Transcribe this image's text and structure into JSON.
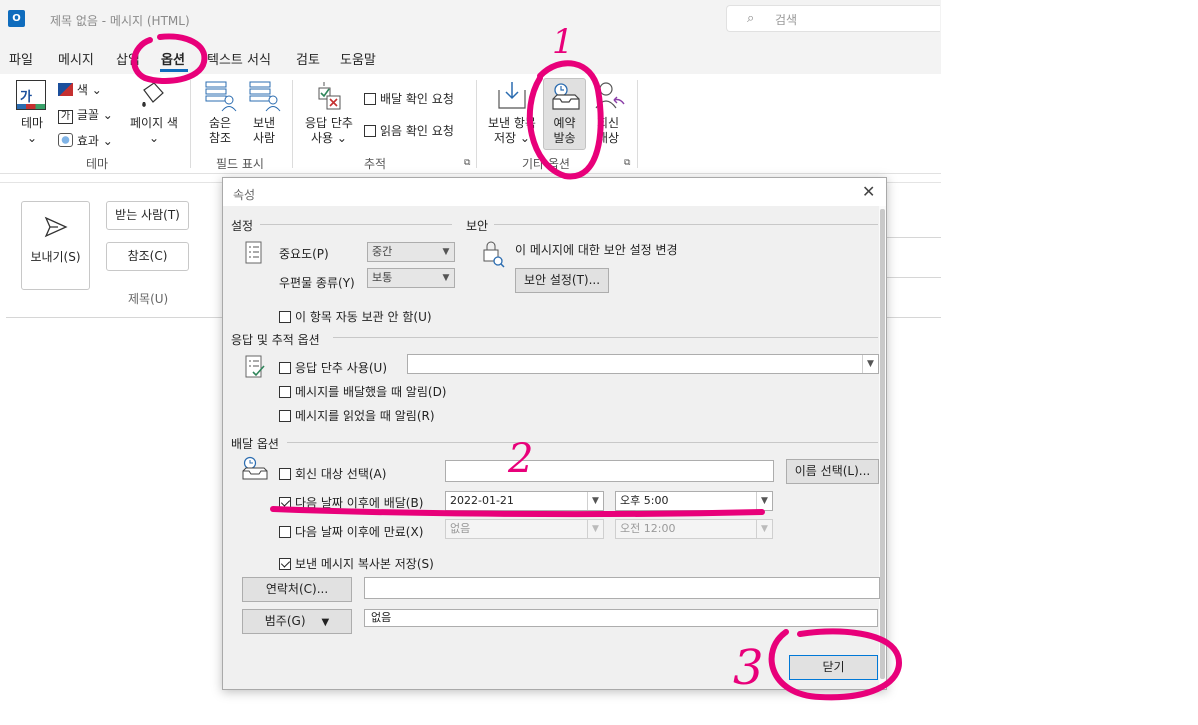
{
  "window": {
    "title": "제목 없음  -  메시지 (HTML)",
    "app_logo": "O",
    "search_placeholder": "검색"
  },
  "tabs": [
    "파일",
    "메시지",
    "삽입",
    "옵션",
    "텍스트 서식",
    "검토",
    "도움말"
  ],
  "ribbon": {
    "theme_group": {
      "label": "테마",
      "theme_button": "테마",
      "theme_icon_text": "가",
      "colors": "색",
      "fonts": "글꼴",
      "effects": "효과",
      "fonts_icon_text": "가",
      "page_color": "페이지 색"
    },
    "fields_group": {
      "label": "필드 표시",
      "bcc_line1": "숨은",
      "bcc_line2": "참조",
      "from_line1": "보낸",
      "from_line2": "사람"
    },
    "tracking_group": {
      "label": "추적",
      "voting_line1": "응답 단추",
      "voting_line2": "사용",
      "delivery_receipt": "배달 확인 요청",
      "read_receipt": "읽음 확인 요청"
    },
    "more_group": {
      "label": "기타 옵션",
      "save_sent_line1": "보낸 항목",
      "save_sent_line2": "저장",
      "delay_line1": "예약",
      "delay_line2": "발송",
      "reply_line1": "회신",
      "reply_line2": "대상"
    }
  },
  "compose": {
    "send": "보내기(S)",
    "to": "받는 사람(T)",
    "cc": "참조(C)",
    "subject": "제목(U)"
  },
  "dialog": {
    "title": "속성",
    "settings": {
      "header": "설정",
      "importance_label": "중요도(P)",
      "importance_value": "중간",
      "sensitivity_label": "우편물 종류(Y)",
      "sensitivity_value": "보통",
      "no_autoarchive": "이 항목 자동 보관 안 함(U)"
    },
    "security": {
      "header": "보안",
      "description": "이 메시지에 대한 보안 설정 변경",
      "button": "보안 설정(T)..."
    },
    "voting": {
      "header": "응답 및 추적 옵션",
      "use_voting": "응답 단추 사용(U)",
      "delivered_receipt": "메시지를 배달했을 때 알림(D)",
      "read_receipt": "메시지를 읽었을 때 알림(R)"
    },
    "delivery": {
      "header": "배달 옵션",
      "have_replies_sent_to": "회신 대상 선택(A)",
      "select_names": "이름 선택(L)...",
      "do_not_deliver_before": "다음 날짜 이후에 배달(B)",
      "deliver_date": "2022-01-21",
      "deliver_time": "오후 5:00",
      "expires_after": "다음 날짜 이후에 만료(X)",
      "expire_date": "없음",
      "expire_time": "오전 12:00",
      "save_copy": "보낸 메시지 복사본 저장(S)"
    },
    "contacts_button": "연락처(C)...",
    "categories_button": "범주(G)",
    "categories_value": "없음",
    "close_button": "닫기"
  },
  "annotations": [
    "1",
    "2",
    "3"
  ],
  "colors": {
    "annotation": "#e8007a",
    "accent": "#0f6cbd"
  }
}
